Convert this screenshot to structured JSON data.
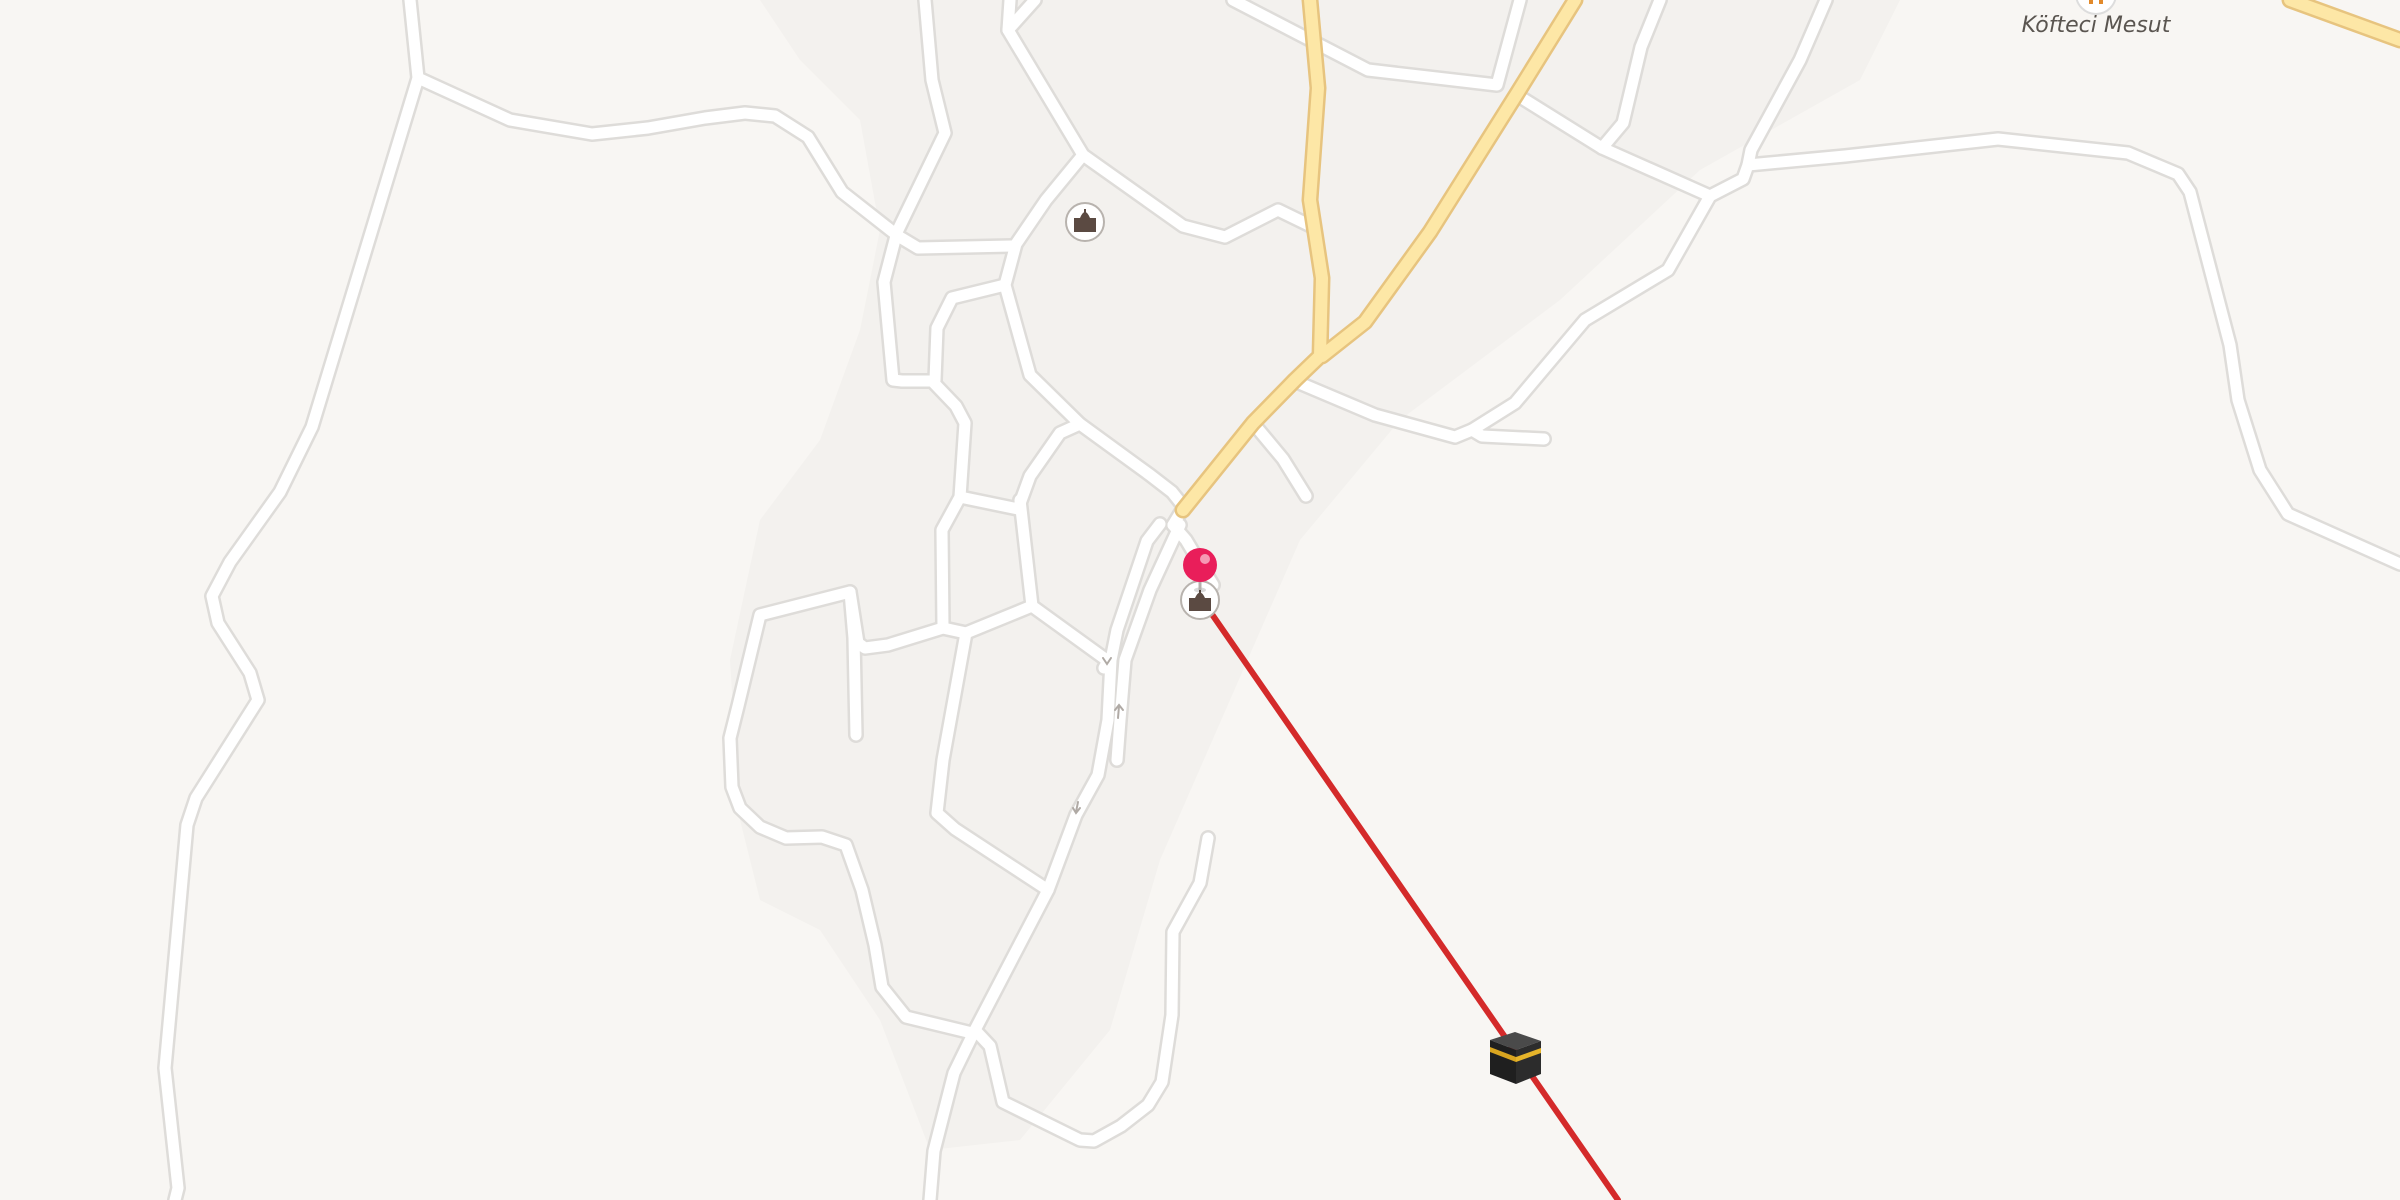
{
  "map": {
    "style": {
      "background": "#f8f6f3",
      "urban_area": "#f3f1ee",
      "minor_road_casing": "#e0dedb",
      "minor_road_fill": "#ffffff",
      "main_road_casing": "#e7c47f",
      "main_road_fill": "#fde7a6",
      "qibla_line": "#d42a2a",
      "pin": "#e91e5a",
      "poi_ring": "#aaaaaa",
      "poi_glyph": "#5b4a42",
      "restaurant_accent": "#e28a2b"
    },
    "pois": {
      "restaurant": {
        "label": "Köfteci Mesut",
        "icon": "fork-knife-icon"
      },
      "landmark_north": {
        "icon": "mosque-icon"
      },
      "mosque_center": {
        "icon": "mosque-icon"
      }
    },
    "location_pin": {
      "icon": "map-pin-icon"
    },
    "qibla": {
      "icon": "kaaba-icon"
    }
  }
}
